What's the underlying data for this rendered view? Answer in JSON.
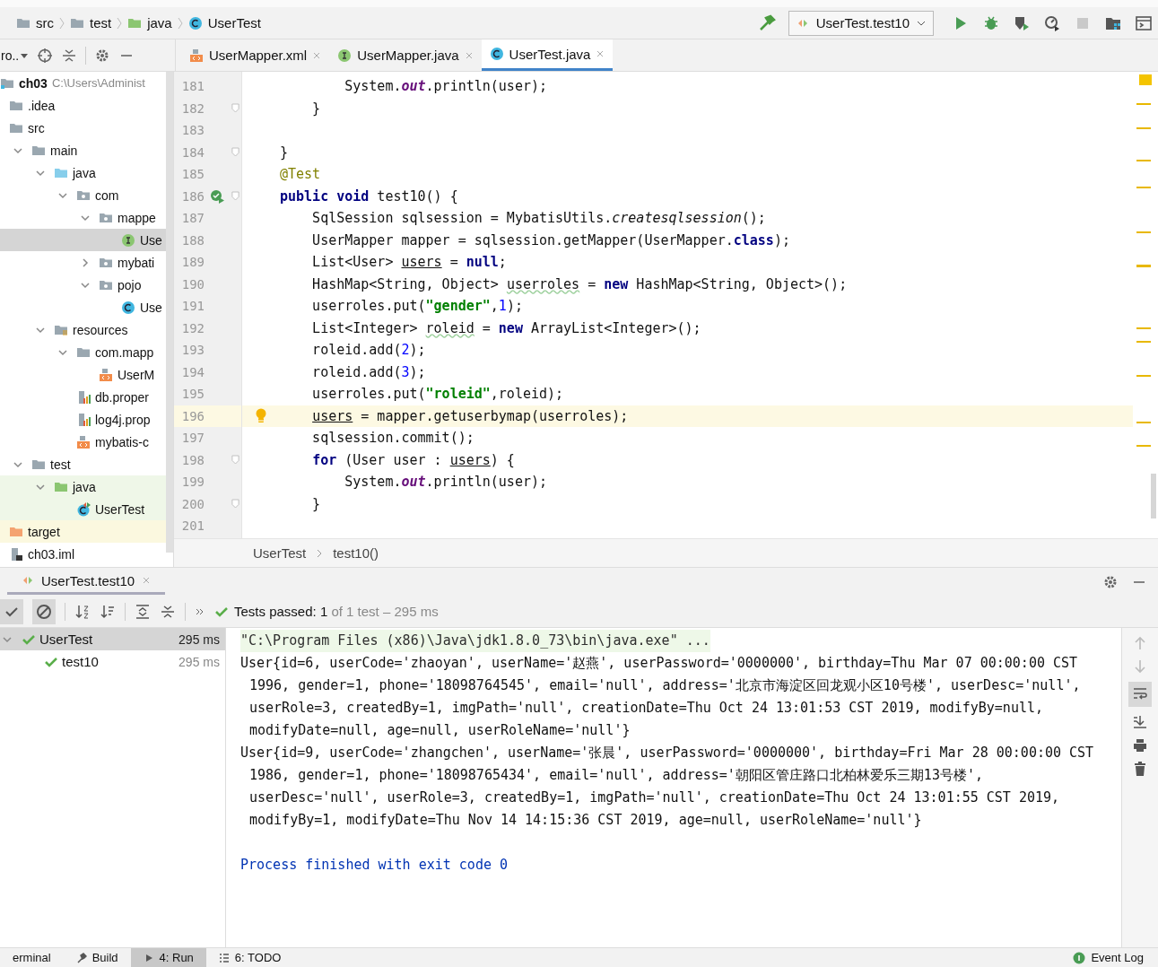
{
  "nav_bar": {
    "breadcrumbs": [
      "src",
      "test",
      "java",
      "UserTest"
    ],
    "run_config": "UserTest.test10"
  },
  "project_panel": {
    "title": "ro..",
    "tree": [
      {
        "label": "ch03",
        "path": "C:\\Users\\Administ",
        "kind": "module",
        "selected": false,
        "children": [
          {
            "label": ".idea",
            "kind": "folder",
            "selected": false
          },
          {
            "label": "src",
            "kind": "folder",
            "selected": false,
            "children": [
              {
                "label": "main",
                "kind": "folder",
                "selected": false,
                "expanded": true,
                "children": [
                  {
                    "label": "java",
                    "kind": "source",
                    "selected": false,
                    "expanded": true,
                    "children": [
                      {
                        "label": "com",
                        "kind": "package",
                        "selected": false,
                        "expanded": true,
                        "children": [
                          {
                            "label": "mappe",
                            "kind": "package",
                            "selected": false,
                            "expanded": true,
                            "children": [
                              {
                                "label": "Use",
                                "kind": "interface",
                                "selected": true
                              }
                            ]
                          },
                          {
                            "label": "mybati",
                            "kind": "package",
                            "selected": false,
                            "expanded": false
                          },
                          {
                            "label": "pojo",
                            "kind": "package",
                            "selected": false,
                            "expanded": true,
                            "children": [
                              {
                                "label": "Use",
                                "kind": "class",
                                "selected": false
                              }
                            ]
                          }
                        ]
                      }
                    ]
                  },
                  {
                    "label": "resources",
                    "kind": "resources",
                    "selected": false,
                    "expanded": true,
                    "children": [
                      {
                        "label": "com.mapp",
                        "kind": "folder",
                        "selected": false,
                        "expanded": true,
                        "children": [
                          {
                            "label": "UserM",
                            "kind": "xml",
                            "selected": false
                          }
                        ]
                      },
                      {
                        "label": "db.proper",
                        "kind": "properties",
                        "selected": false
                      },
                      {
                        "label": "log4j.prop",
                        "kind": "properties",
                        "selected": false
                      },
                      {
                        "label": "mybatis-c",
                        "kind": "xml",
                        "selected": false
                      }
                    ]
                  }
                ]
              },
              {
                "label": "test",
                "kind": "folder",
                "selected": false,
                "expanded": true,
                "children": [
                  {
                    "label": "java",
                    "kind": "test-source",
                    "selected": false,
                    "expanded": true,
                    "children": [
                      {
                        "label": "UserTest",
                        "kind": "test-class",
                        "selected": false
                      }
                    ]
                  }
                ]
              }
            ]
          },
          {
            "label": "target",
            "kind": "excluded",
            "selected": false
          },
          {
            "label": "ch03.iml",
            "kind": "iml",
            "selected": false
          }
        ]
      }
    ]
  },
  "editor": {
    "tabs": [
      {
        "label": "UserMapper.xml",
        "kind": "xml",
        "selected": false
      },
      {
        "label": "UserMapper.java",
        "kind": "interface",
        "selected": false
      },
      {
        "label": "UserTest.java",
        "kind": "class",
        "selected": true
      }
    ],
    "lines": [
      {
        "number": "181",
        "tokens": [
          {
            "t": "        System.",
            "kind": "p"
          },
          {
            "t": "out",
            "kind": "field"
          },
          {
            "t": ".println(user);",
            "kind": "p"
          }
        ]
      },
      {
        "number": "182",
        "fold": true,
        "tokens": [
          {
            "t": "    }",
            "kind": "p"
          }
        ]
      },
      {
        "number": "183"
      },
      {
        "number": "184",
        "fold": true,
        "tokens": [
          {
            "t": "}",
            "kind": "p"
          }
        ]
      },
      {
        "number": "185",
        "tokens": [
          {
            "t": "@Test",
            "kind": "anno"
          }
        ]
      },
      {
        "number": "186",
        "fold": true,
        "run_marker": true,
        "tokens": [
          {
            "t": "public void",
            "kind": "kw"
          },
          {
            "t": " test10() {",
            "kind": "p"
          }
        ]
      },
      {
        "number": "187",
        "tokens": [
          {
            "t": "    SqlSession sqlsession = MybatisUtils.",
            "kind": "p"
          },
          {
            "t": "createsqlsession",
            "kind": "method"
          },
          {
            "t": "();",
            "kind": "p"
          }
        ]
      },
      {
        "number": "188",
        "tokens": [
          {
            "t": "    UserMapper mapper = sqlsession.getMapper(UserMapper.",
            "kind": "p"
          },
          {
            "t": "class",
            "kind": "kw"
          },
          {
            "t": ");",
            "kind": "p"
          }
        ]
      },
      {
        "number": "189",
        "tokens": [
          {
            "t": "    List<User> ",
            "kind": "p"
          },
          {
            "t": "users",
            "kind": "ul"
          },
          {
            "t": " = ",
            "kind": "p"
          },
          {
            "t": "null",
            "kind": "kw"
          },
          {
            "t": ";",
            "kind": "p"
          }
        ]
      },
      {
        "number": "190",
        "tokens": [
          {
            "t": "    HashMap<String, Object> ",
            "kind": "p"
          },
          {
            "t": "userroles",
            "kind": "wavy"
          },
          {
            "t": " = ",
            "kind": "p"
          },
          {
            "t": "new",
            "kind": "kw"
          },
          {
            "t": " HashMap<String, Object>();",
            "kind": "p"
          }
        ]
      },
      {
        "number": "191",
        "tokens": [
          {
            "t": "    userroles.put(",
            "kind": "p"
          },
          {
            "t": "\"gender\"",
            "kind": "str"
          },
          {
            "t": ",",
            "kind": "p"
          },
          {
            "t": "1",
            "kind": "num"
          },
          {
            "t": ");",
            "kind": "p"
          }
        ]
      },
      {
        "number": "192",
        "tokens": [
          {
            "t": "    List<Integer> ",
            "kind": "p"
          },
          {
            "t": "roleid",
            "kind": "wavy"
          },
          {
            "t": " = ",
            "kind": "p"
          },
          {
            "t": "new",
            "kind": "kw"
          },
          {
            "t": " ArrayList<Integer>();",
            "kind": "p"
          }
        ]
      },
      {
        "number": "193",
        "tokens": [
          {
            "t": "    roleid.add(",
            "kind": "p"
          },
          {
            "t": "2",
            "kind": "num"
          },
          {
            "t": ");",
            "kind": "p"
          }
        ]
      },
      {
        "number": "194",
        "tokens": [
          {
            "t": "    roleid.add(",
            "kind": "p"
          },
          {
            "t": "3",
            "kind": "num"
          },
          {
            "t": ");",
            "kind": "p"
          }
        ]
      },
      {
        "number": "195",
        "tokens": [
          {
            "t": "    userroles.put(",
            "kind": "p"
          },
          {
            "t": "\"roleid\"",
            "kind": "str"
          },
          {
            "t": ",roleid);",
            "kind": "p"
          }
        ]
      },
      {
        "number": "196",
        "highlighted": true,
        "intention_bulb": true,
        "tokens": [
          {
            "t": "    users",
            "kind": "ul"
          },
          {
            "t": " = mapper.getuserbymap(userroles);",
            "kind": "p"
          }
        ]
      },
      {
        "number": "197",
        "tokens": [
          {
            "t": "    sqlsession.commit();",
            "kind": "p"
          }
        ]
      },
      {
        "number": "198",
        "fold": true,
        "tokens": [
          {
            "t": "    for",
            "kind": "kw"
          },
          {
            "t": " (User user : ",
            "kind": "p"
          },
          {
            "t": "users",
            "kind": "ul"
          },
          {
            "t": ") {",
            "kind": "p"
          }
        ]
      },
      {
        "number": "199",
        "tokens": [
          {
            "t": "        System.",
            "kind": "p"
          },
          {
            "t": "out",
            "kind": "field"
          },
          {
            "t": ".println(user);",
            "kind": "p"
          }
        ]
      },
      {
        "number": "200",
        "fold": true,
        "tokens": [
          {
            "t": "    }",
            "kind": "p"
          }
        ]
      },
      {
        "number": "201"
      }
    ],
    "breadcrumbs": [
      "UserTest",
      "test10()"
    ]
  },
  "run_panel": {
    "tab": "UserTest.test10",
    "status": {
      "label": "Tests passed:",
      "count": "1",
      "detail": "of 1 test – 295 ms"
    },
    "tests": [
      {
        "name": "UserTest",
        "time": "295 ms",
        "passed": true,
        "selected": true,
        "expanded": true,
        "children": [
          {
            "name": "test10",
            "time": "295 ms",
            "passed": true,
            "selected": false
          }
        ]
      }
    ],
    "console": [
      {
        "kind": "command",
        "text": "\"C:\\Program Files (x86)\\Java\\jdk1.8.0_73\\bin\\java.exe\" ..."
      },
      {
        "kind": "output",
        "text": "User{id=6, userCode='zhaoyan', userName='赵燕', userPassword='0000000', birthday=Thu Mar 07 00:00:00 CST 1996, gender=1, phone='18098764545', email='null', address='北京市海淀区回龙观小区10号楼', userDesc='null', userRole=3, createdBy=1, imgPath='null', creationDate=Thu Oct 24 13:01:53 CST 2019, modifyBy=null, modifyDate=null, age=null, userRoleName='null'}"
      },
      {
        "kind": "output",
        "text": "User{id=9, userCode='zhangchen', userName='张晨', userPassword='0000000', birthday=Fri Mar 28 00:00:00 CST 1986, gender=1, phone='18098765434', email='null', address='朝阳区管庄路口北柏林爱乐三期13号楼', userDesc='null', userRole=3, createdBy=1, imgPath='null', creationDate=Thu Oct 24 13:01:55 CST 2019, modifyBy=1, modifyDate=Thu Nov 14 14:15:36 CST 2019, age=null, userRoleName='null'}"
      },
      {
        "kind": "system",
        "text": "Process finished with exit code 0"
      }
    ]
  },
  "tool_window_bar": {
    "tabs": [
      {
        "label": "erminal",
        "kind": "plain",
        "selected": false
      },
      {
        "label": "Build",
        "kind": "build",
        "selected": false
      },
      {
        "label": "4: Run",
        "kind": "run",
        "selected": true
      },
      {
        "label": "6: TODO",
        "kind": "todo",
        "selected": false
      }
    ],
    "event_log": "Event Log"
  }
}
